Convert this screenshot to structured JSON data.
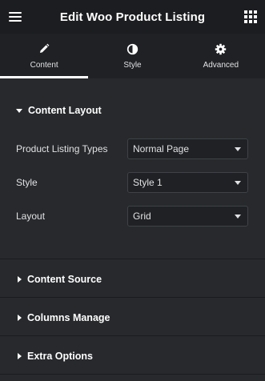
{
  "header": {
    "title": "Edit Woo Product Listing",
    "menu_icon": "hamburger-menu-icon",
    "grid_icon": "apps-grid-icon"
  },
  "tabs": [
    {
      "label": "Content",
      "icon": "pencil-icon",
      "active": true
    },
    {
      "label": "Style",
      "icon": "half-circle-contrast-icon",
      "active": false
    },
    {
      "label": "Advanced",
      "icon": "gear-icon",
      "active": false
    }
  ],
  "content_layout": {
    "title": "Content Layout",
    "controls": [
      {
        "label": "Product Listing Types",
        "value": "Normal Page"
      },
      {
        "label": "Style",
        "value": "Style 1"
      },
      {
        "label": "Layout",
        "value": "Grid"
      }
    ]
  },
  "sections": [
    {
      "title": "Content Source"
    },
    {
      "title": "Columns Manage"
    },
    {
      "title": "Extra Options"
    }
  ],
  "colors": {
    "background": "#27292c",
    "header": "#1c1d20",
    "tabs_bar": "#1f2124",
    "text": "#e0e1e3",
    "active_indicator": "#ffffff"
  }
}
